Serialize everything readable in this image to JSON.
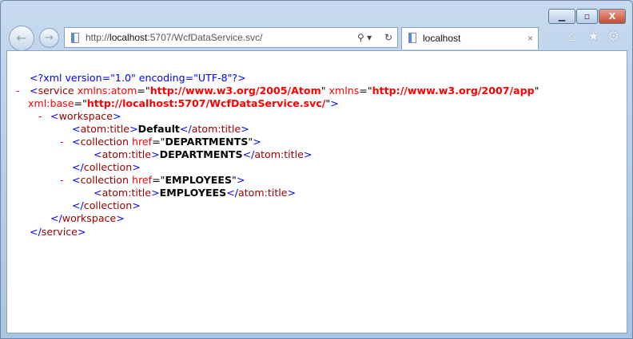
{
  "browser": {
    "url_prefix": "http://",
    "url_host": "localhost",
    "url_rest": ":5707/WcfDataService.svc/",
    "tab_title": "localhost",
    "tab_close": "×",
    "minimize": "▁",
    "maximize": "▫",
    "close": "X",
    "back": "←",
    "forward": "→",
    "search": "⚲ ▾",
    "refresh": "↻",
    "home": "⌂",
    "favorites": "★",
    "settings": "⚙"
  },
  "xml": {
    "decl": "<?xml version=\"1.0\" encoding=\"UTF-8\"?>",
    "dash": "-",
    "lt": "<",
    "gt": ">",
    "close_lt": "</",
    "eq": "=",
    "quote": "\"",
    "service": "service",
    "xmlns_atom": "xmlns:atom",
    "atom_ns": "http://www.w3.org/2005/Atom",
    "xmlns": "xmlns",
    "app_ns": "http://www.w3.org/2007/app",
    "xml_base": "xml:base",
    "base_val": "http://localhost:5707/WcfDataService.svc/",
    "workspace": "workspace",
    "atom_title": "atom:title",
    "default": "Default",
    "collection": "collection",
    "href": "href",
    "dept": "DEPARTMENTS",
    "emp": "EMPLOYEES"
  }
}
